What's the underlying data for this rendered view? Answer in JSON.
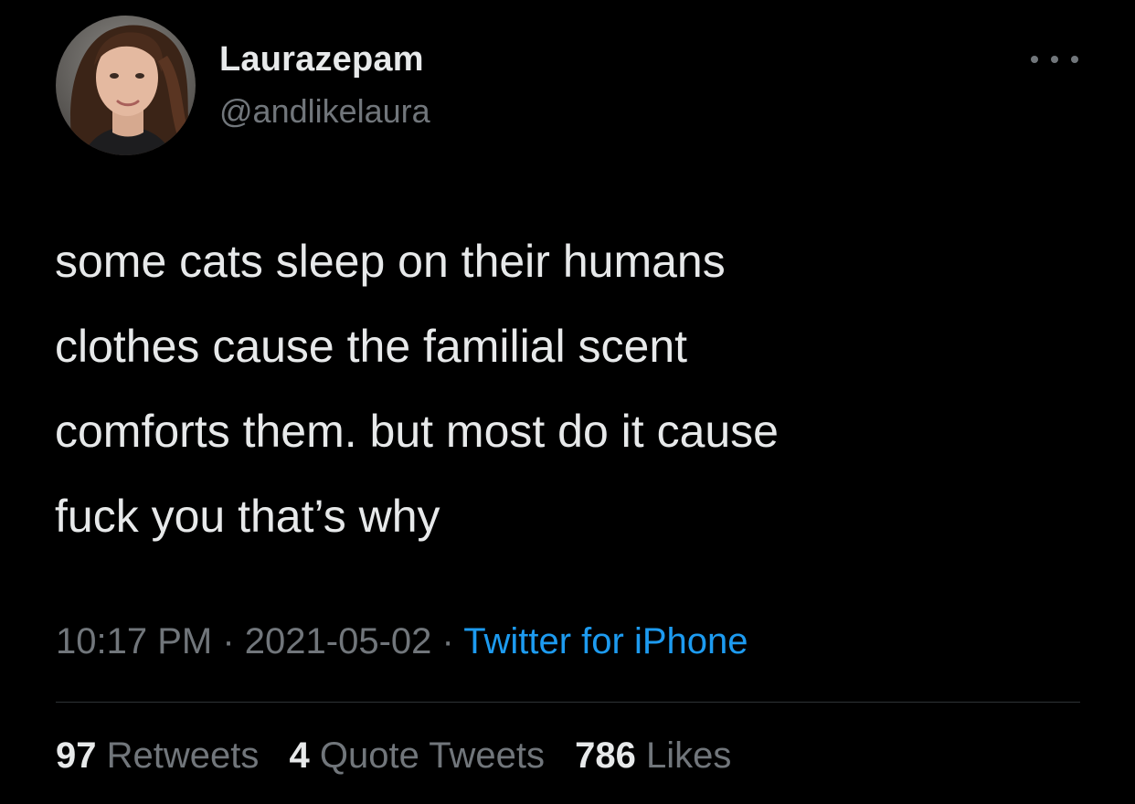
{
  "author": {
    "display_name": "Laurazepam",
    "handle": "@andlikelaura"
  },
  "tweet": {
    "text_lines": [
      "some cats sleep on their humans",
      "clothes cause the familial scent",
      "comforts them. but most do it cause",
      "fuck you that’s why"
    ],
    "time": "10:17 PM",
    "separator": "·",
    "date": "2021-05-02",
    "source": "Twitter for iPhone"
  },
  "stats": {
    "retweets_count": "97",
    "retweets_label": "Retweets",
    "quotes_count": "4",
    "quotes_label": "Quote Tweets",
    "likes_count": "786",
    "likes_label": "Likes"
  },
  "icons": {
    "more": "more-horizontal-icon"
  },
  "colors": {
    "background": "#000000",
    "primary_text": "#e7e9ea",
    "secondary_text": "#71767b",
    "link": "#1d9bf0",
    "divider": "#2f3336"
  }
}
